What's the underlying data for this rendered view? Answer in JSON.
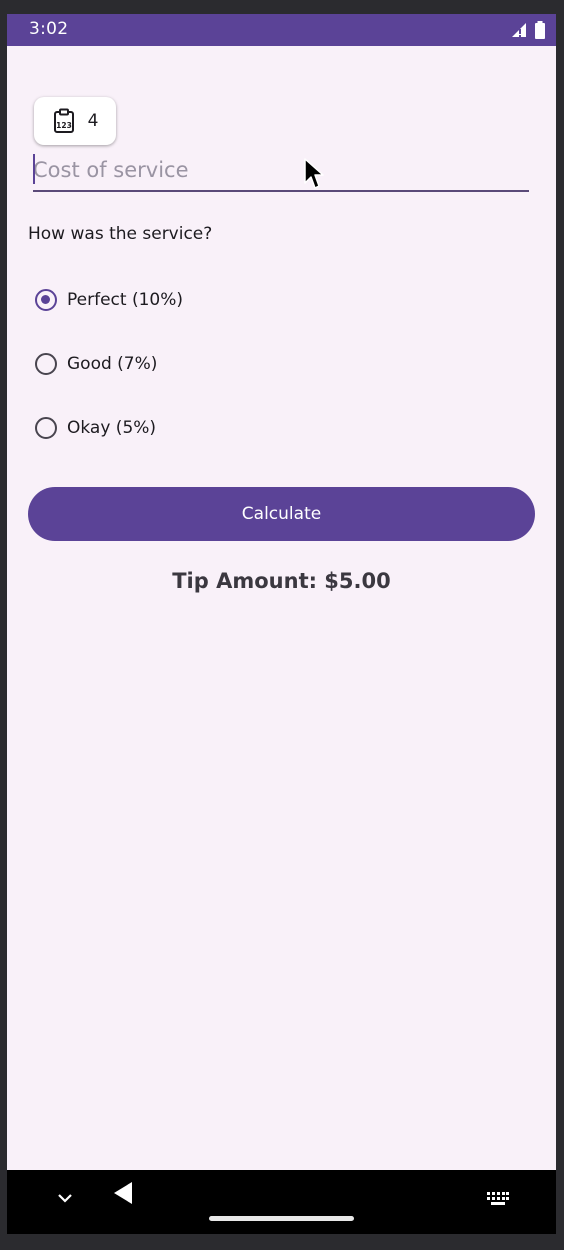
{
  "status_bar": {
    "time": "3:02",
    "background_color": "#5b4397",
    "icons": [
      "signal-icon",
      "battery-icon"
    ]
  },
  "clipboard_chip": {
    "icon": "clipboard-numbers-icon",
    "count": "4"
  },
  "cost_input": {
    "placeholder": "Cost of service",
    "value": ""
  },
  "service": {
    "question": "How was the service?",
    "options": [
      {
        "label": "Perfect (10%)",
        "selected": true
      },
      {
        "label": "Good (7%)",
        "selected": false
      },
      {
        "label": "Okay (5%)",
        "selected": false
      }
    ]
  },
  "calculate_button": {
    "label": "Calculate"
  },
  "result": {
    "tip_amount": "Tip Amount: $5.00"
  },
  "nav_bar": {
    "icons": [
      "chevron-down-icon",
      "back-icon",
      "home-handle",
      "keyboard-icon"
    ]
  },
  "colors": {
    "accent": "#5b4397",
    "background": "#f9f1f9",
    "text": "#1d1b20"
  }
}
